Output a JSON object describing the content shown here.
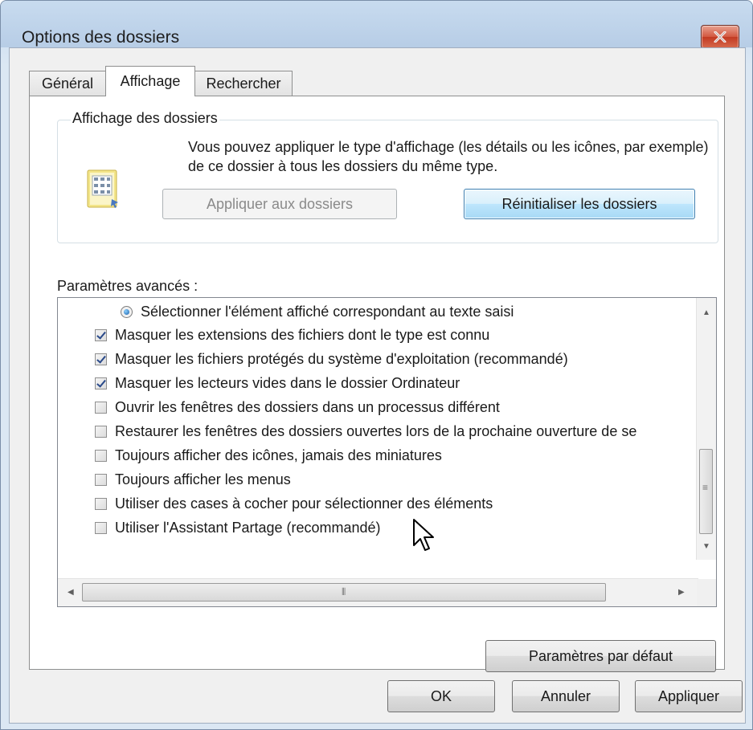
{
  "window": {
    "title": "Options des dossiers",
    "close_icon": "close-icon"
  },
  "tabs": [
    {
      "label": "Général"
    },
    {
      "label": "Affichage"
    },
    {
      "label": "Rechercher"
    }
  ],
  "folder_views": {
    "legend": "Affichage des dossiers",
    "description": "Vous pouvez appliquer le type d'affichage (les détails ou les icônes, par exemple) de ce dossier à tous les dossiers du même type.",
    "apply_button": "Appliquer aux dossiers",
    "reset_button": "Réinitialiser les dossiers",
    "icon": "folder-view-icon"
  },
  "advanced": {
    "label": "Paramètres avancés :",
    "items": [
      {
        "text": "Sélectionner l'élément affiché correspondant au texte saisi",
        "type": "radio",
        "checked": true
      },
      {
        "text": "Masquer les extensions des fichiers dont le type est connu",
        "type": "checkbox",
        "checked": true
      },
      {
        "text": "Masquer les fichiers protégés du système d'exploitation (recommandé)",
        "type": "checkbox",
        "checked": true
      },
      {
        "text": "Masquer les lecteurs vides dans le dossier Ordinateur",
        "type": "checkbox",
        "checked": true
      },
      {
        "text": "Ouvrir les fenêtres des dossiers dans un processus différent",
        "type": "checkbox",
        "checked": false
      },
      {
        "text": "Restaurer les fenêtres des dossiers ouvertes lors de la prochaine ouverture de se",
        "type": "checkbox",
        "checked": false
      },
      {
        "text": "Toujours afficher des icônes, jamais des miniatures",
        "type": "checkbox",
        "checked": false
      },
      {
        "text": "Toujours afficher les menus",
        "type": "checkbox",
        "checked": false
      },
      {
        "text": "Utiliser des cases à cocher pour sélectionner des éléments",
        "type": "checkbox",
        "checked": false
      },
      {
        "text": "Utiliser l'Assistant Partage (recommandé)",
        "type": "checkbox",
        "checked": false
      }
    ],
    "defaults_button": "Paramètres par défaut"
  },
  "footer": {
    "ok": "OK",
    "cancel": "Annuler",
    "apply": "Appliquer"
  }
}
